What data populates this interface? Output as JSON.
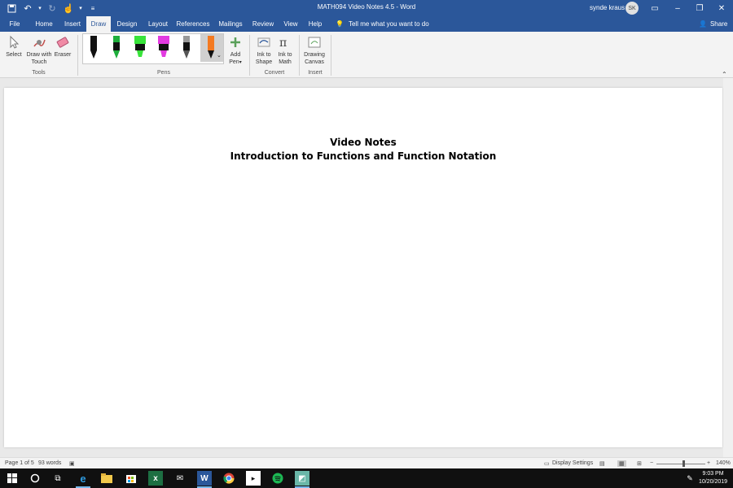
{
  "titlebar": {
    "title": "MATH094 Video Notes 4.5  -  Word",
    "user_name": "synde kraus",
    "user_initials": "SK"
  },
  "tabs": [
    {
      "label": "File"
    },
    {
      "label": "Home"
    },
    {
      "label": "Insert"
    },
    {
      "label": "Draw"
    },
    {
      "label": "Design"
    },
    {
      "label": "Layout"
    },
    {
      "label": "References"
    },
    {
      "label": "Mailings"
    },
    {
      "label": "Review"
    },
    {
      "label": "View"
    },
    {
      "label": "Help"
    }
  ],
  "active_tab": "Draw",
  "tell_me": "Tell me what you want to do",
  "share_label": "Share",
  "ribbon": {
    "tools": {
      "select": "Select",
      "draw_with_touch_1": "Draw with",
      "draw_with_touch_2": "Touch",
      "eraser": "Eraser",
      "group_label": "Tools"
    },
    "pens": {
      "group_label": "Pens",
      "colors": [
        "#111111",
        "#1fae3c",
        "#38e33a",
        "#e23ae0",
        "#555555",
        "#f47a21"
      ]
    },
    "add_pen_1": "Add",
    "add_pen_2": "Pen",
    "convert": {
      "ink_to_shape_1": "Ink to",
      "ink_to_shape_2": "Shape",
      "ink_to_math_1": "Ink to",
      "ink_to_math_2": "Math",
      "group_label": "Convert"
    },
    "insert": {
      "drawing_canvas_1": "Drawing",
      "drawing_canvas_2": "Canvas",
      "group_label": "Insert"
    }
  },
  "document": {
    "heading_line1": "Video Notes",
    "heading_line2": "Introduction to Functions and Function Notation"
  },
  "statusbar": {
    "page": "Page 1 of 5",
    "words": "93 words",
    "display_settings": "Display Settings",
    "zoom": "140%"
  },
  "taskbar": {
    "time": "9:03 PM",
    "date": "10/20/2019"
  },
  "colors": {
    "word_blue": "#2b579a",
    "ribbon_bg": "#f3f3f3",
    "taskbar_bg": "#101010"
  }
}
